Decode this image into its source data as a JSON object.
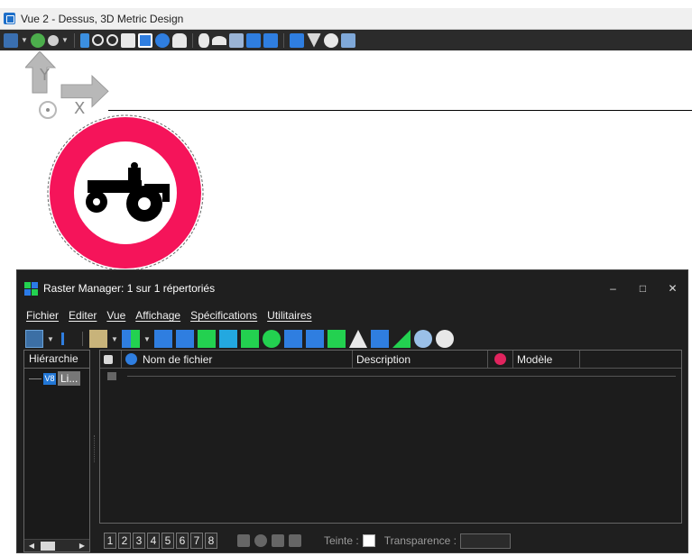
{
  "view": {
    "title": "Vue 2 - Dessus, 3D Metric Design",
    "axis_y_label": "Y",
    "axis_x_label": "X",
    "toolbar_icons": [
      "view-attributes-icon",
      "view-display-icon",
      "lighting-icon",
      "paint-brush-icon",
      "zoom-in-icon",
      "zoom-out-icon",
      "window-area-icon",
      "fit-view-icon",
      "rotate-view-icon",
      "pan-view-icon",
      "walk-icon",
      "fly-icon",
      "camera-icon",
      "previous-view-icon",
      "next-view-icon",
      "copy-view-icon",
      "clip-volume-icon",
      "saved-views-icon",
      "dynamic-view-icon"
    ]
  },
  "raster_manager": {
    "title": "Raster Manager: 1 sur 1 répertoriés",
    "window_controls": {
      "minimize": "–",
      "maximize": "□",
      "close": "✕"
    },
    "menu": [
      {
        "label": "Fichier"
      },
      {
        "label": "Editer"
      },
      {
        "label": "Vue"
      },
      {
        "label": "Affichage"
      },
      {
        "label": "Spécifications"
      },
      {
        "label": "Utilitaires"
      }
    ],
    "hierarchy": {
      "header": "Hiérarchie",
      "badge": "V8",
      "item_label": "Li..."
    },
    "columns": {
      "filename": "Nom de fichier",
      "description": "Description",
      "model": "Modèle"
    },
    "pages": [
      "1",
      "2",
      "3",
      "4",
      "5",
      "6",
      "7",
      "8"
    ],
    "status": {
      "tint_label": "Teinte :",
      "transparency_label": "Transparence :"
    }
  },
  "colors": {
    "sign_ring": "#f5145a",
    "toolbar_bg": "#2b2b2b",
    "window_bg": "#1f1f1f",
    "axis_gray": "#b8b8b8"
  }
}
